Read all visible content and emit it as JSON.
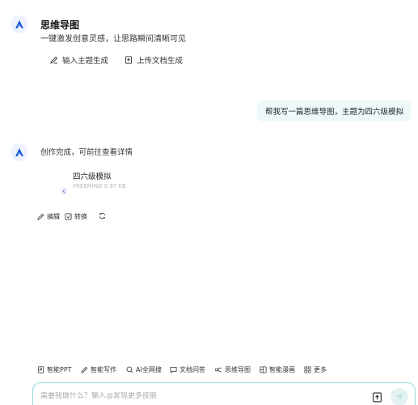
{
  "intro": {
    "title": "思维导图",
    "subtitle": "一键激发创意灵感，让思路瞬间清晰可见",
    "actions": [
      {
        "label": "输入主题生成",
        "icon": "pen-icon"
      },
      {
        "label": "上传文档生成",
        "icon": "upload-doc-icon"
      }
    ]
  },
  "user_message": "帮我写一篇思维导图，主题为四六级模拟",
  "reply": {
    "text": "创作完成，可前往查看详情",
    "file": {
      "name": "四六级模拟",
      "meta": "FREEMIND 8.97 KB"
    },
    "actions": [
      {
        "label": "编辑",
        "icon": "edit-icon"
      },
      {
        "label": "转换",
        "icon": "convert-icon"
      },
      {
        "label": "",
        "icon": "refresh-icon"
      }
    ]
  },
  "toolbar": [
    {
      "label": "智能PPT",
      "icon": "ppt-icon"
    },
    {
      "label": "智能写作",
      "icon": "write-icon"
    },
    {
      "label": "AI全网搜",
      "icon": "search-icon"
    },
    {
      "label": "文档问答",
      "icon": "chat-doc-icon"
    },
    {
      "label": "思维导图",
      "icon": "mindmap-icon"
    },
    {
      "label": "智能漫画",
      "icon": "comic-icon"
    },
    {
      "label": "更多",
      "icon": "grid-icon"
    }
  ],
  "input": {
    "placeholder": "需要我做什么？输入@发现更多技能"
  },
  "colors": {
    "accent": "#1a56db",
    "teal": "#9ad7d7",
    "bubble": "#eef8f8"
  }
}
